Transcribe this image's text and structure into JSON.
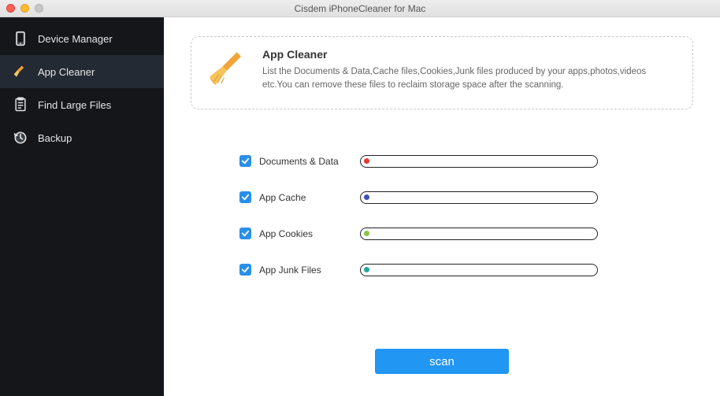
{
  "titlebar": {
    "title": "Cisdem iPhoneCleaner for Mac"
  },
  "sidebar": {
    "items": [
      {
        "label": "Device Manager"
      },
      {
        "label": "App Cleaner"
      },
      {
        "label": "Find Large Files"
      },
      {
        "label": "Backup"
      }
    ]
  },
  "info": {
    "heading": "App Cleaner",
    "description": "List the Documents & Data,Cache files,Cookies,Junk files produced by your apps,photos,videos etc.You can remove these files to reclaim storage space after the scanning."
  },
  "categories": [
    {
      "label": "Documents & Data",
      "checked": true,
      "dot_color": "#e53935"
    },
    {
      "label": "App Cache",
      "checked": true,
      "dot_color": "#3f51b5"
    },
    {
      "label": "App Cookies",
      "checked": true,
      "dot_color": "#8bc34a"
    },
    {
      "label": "App Junk Files",
      "checked": true,
      "dot_color": "#26a69a"
    }
  ],
  "scan_button": {
    "label": "scan"
  }
}
